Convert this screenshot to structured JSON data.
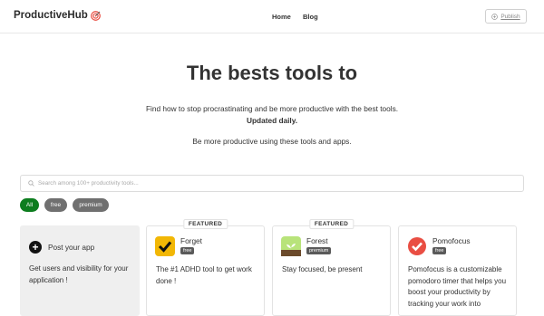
{
  "header": {
    "brand": "ProductiveHub",
    "nav": [
      {
        "label": "Home"
      },
      {
        "label": "Blog"
      }
    ],
    "publish_label": "Publish"
  },
  "hero": {
    "title": "The bests tools to",
    "line1": "Find how to stop procrastinating and be more productive with the best tools.",
    "line2": "Updated daily.",
    "line3": "Be more productive using these tools and apps."
  },
  "search": {
    "placeholder": "Search among 100+ productivity tools..."
  },
  "filters": [
    {
      "label": "All"
    },
    {
      "label": "free"
    },
    {
      "label": "premium"
    }
  ],
  "post_card": {
    "title": "Post your app",
    "description": "Get users and visibility for your application !"
  },
  "tools": [
    {
      "badge": "FEATURED",
      "name": "Forget",
      "tier": "free",
      "description": "The #1 ADHD tool to get work done !",
      "icon": "checkmark-icon",
      "icon_color": "#f2b705"
    },
    {
      "badge": "FEATURED",
      "name": "Forest",
      "tier": "premium",
      "description": "Stay focused, be present",
      "icon": "plant-icon",
      "icon_color": "#b8e37a"
    },
    {
      "badge": "",
      "name": "Pomofocus",
      "tier": "free",
      "description": "Pomofocus is a customizable pomodoro timer that helps you boost your productivity by tracking your work into",
      "icon": "pomodoro-check-icon",
      "icon_color": "#e94e43"
    }
  ],
  "colors": {
    "accent_green": "#0d7d1f",
    "brand_target": "#e94e43",
    "chip_gray": "#707070"
  }
}
